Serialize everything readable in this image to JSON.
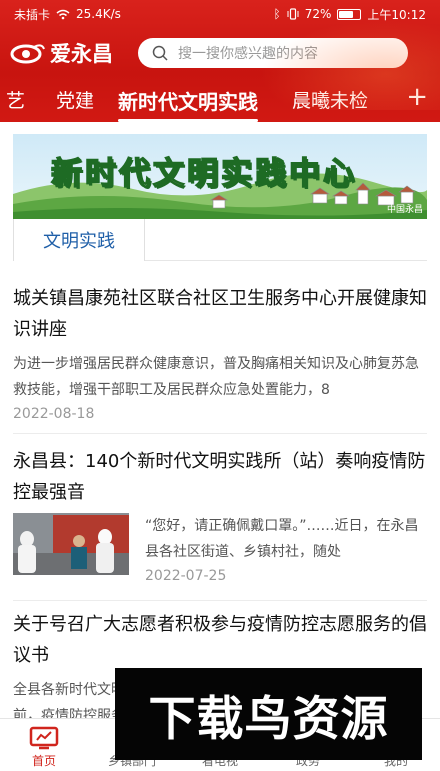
{
  "status_bar": {
    "carrier": "未插卡",
    "speed": "25.4K/s",
    "battery_percent": "72%",
    "battery_level": 0.72,
    "time": "上午10:12"
  },
  "app": {
    "name": "爱永昌",
    "search_placeholder": "搜一搜你感兴趣的内容",
    "brand_color": "#d0251d"
  },
  "channel_tabs": [
    {
      "label": "艺",
      "active": false
    },
    {
      "label": "党建",
      "active": false
    },
    {
      "label": "新时代文明实践",
      "active": true
    },
    {
      "label": "晨曦未检",
      "active": false
    }
  ],
  "add_channel": "+",
  "banner": {
    "title": "新时代文明实践中心",
    "credit": "中国永昌"
  },
  "section_tab": "文明实践",
  "news": [
    {
      "title": "城关镇昌康苑社区联合社区卫生服务中心开展健康知识讲座",
      "summary": "为进一步增强居民群众健康意识，普及胸痛相关知识及心肺复苏急救技能，增强干部职工及居民群众应急处置能力，8",
      "date": "2022-08-18"
    },
    {
      "title": "永昌县：140个新时代文明实践所（站）奏响疫情防控最强音",
      "summary": "“您好，请正确佩戴口罩。”……近日，在永昌县各社区街道、乡镇村社，随处",
      "date": "2022-07-25"
    },
    {
      "title": "关于号召广大志愿者积极参与疫情防控志愿服务的倡议书",
      "summary": "全县各新时代文明实践所（站）志愿服务组织和广大志愿者：目前，疫情防控服务组织和广大志",
      "date": ""
    }
  ],
  "bottom_nav": [
    {
      "label": "首页",
      "icon": "tv-icon",
      "active": true
    },
    {
      "label": "乡镇部门",
      "icon": "building-icon",
      "active": false
    },
    {
      "label": "看电视",
      "icon": "television-icon",
      "active": false
    },
    {
      "label": "政务",
      "icon": "gov-icon",
      "active": false
    },
    {
      "label": "我的",
      "icon": "user-icon",
      "active": false
    }
  ],
  "watermark": "下载鸟资源"
}
